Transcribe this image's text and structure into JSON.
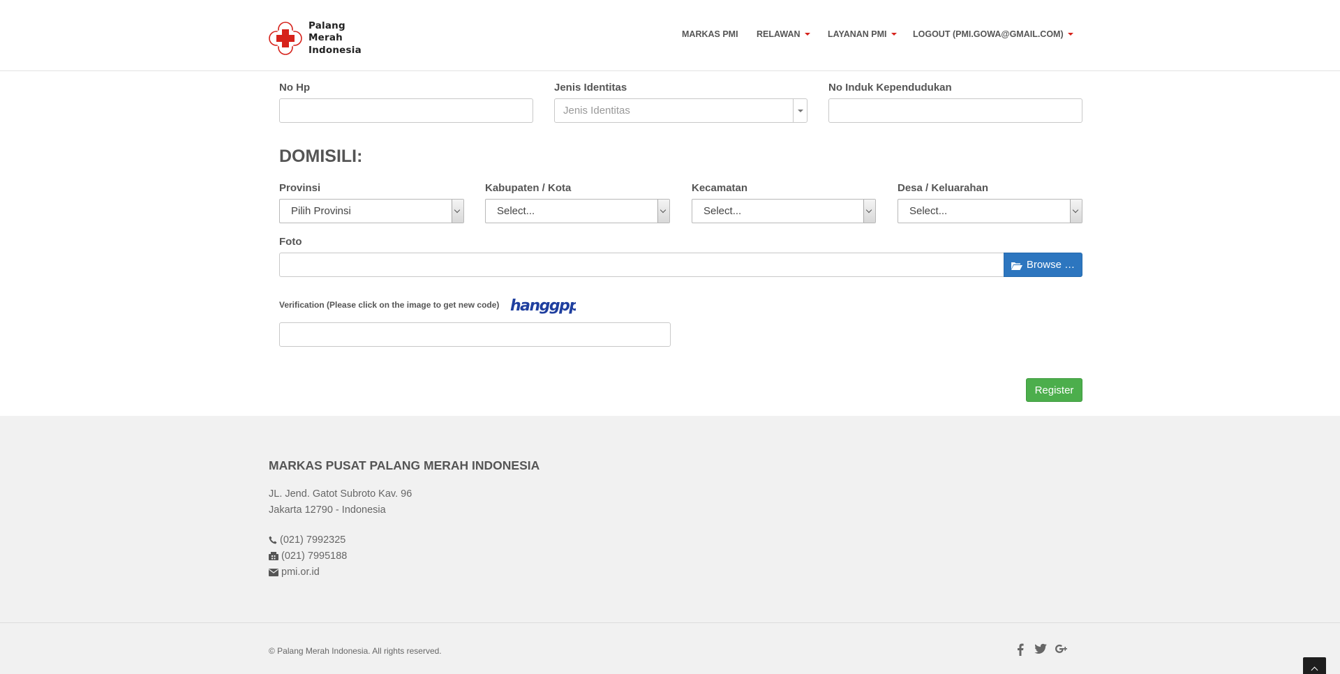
{
  "brand": {
    "name_line1": "Palang",
    "name_line2": "Merah",
    "name_line3": "Indonesia",
    "accent_color": "#d6221b"
  },
  "nav": {
    "items": [
      {
        "label": "MARKAS PMI",
        "dropdown": false
      },
      {
        "label": "RELAWAN",
        "dropdown": true
      },
      {
        "label": "LAYANAN PMI",
        "dropdown": true
      },
      {
        "label": "LOGOUT (PMI.GOWA@GMAIL.COM)",
        "dropdown": true
      }
    ]
  },
  "form": {
    "no_hp": {
      "label": "No Hp",
      "value": ""
    },
    "jenis_identitas": {
      "label": "Jenis Identitas",
      "placeholder": "Jenis Identitas"
    },
    "nik": {
      "label": "No Induk Kependudukan",
      "value": ""
    },
    "domisili_title": "DOMISILI:",
    "provinsi": {
      "label": "Provinsi",
      "selected": "Pilih Provinsi"
    },
    "kabupaten": {
      "label": "Kabupaten / Kota",
      "selected": "Select..."
    },
    "kecamatan": {
      "label": "Kecamatan",
      "selected": "Select..."
    },
    "desa": {
      "label": "Desa / Keluarahan",
      "selected": "Select..."
    },
    "foto": {
      "label": "Foto",
      "value": "",
      "browse_label": "Browse …"
    },
    "verification": {
      "label": "Verification (Please click on the image to get new code)",
      "captcha_text": "hanggpp",
      "value": ""
    },
    "register_label": "Register"
  },
  "footer": {
    "title": "MARKAS PUSAT PALANG MERAH INDONESIA",
    "address_line1": "JL. Jend. Gatot Subroto Kav. 96",
    "address_line2": "Jakarta 12790 - Indonesia",
    "phone": "(021) 7992325",
    "fax": "(021) 7995188",
    "web": "pmi.or.id",
    "copyright": "© Palang Merah Indonesia. All rights reserved.",
    "social": [
      {
        "icon": "facebook-icon",
        "glyph": "f"
      },
      {
        "icon": "twitter-icon",
        "glyph": "t"
      },
      {
        "icon": "google-plus-icon",
        "glyph": "g+"
      }
    ]
  }
}
